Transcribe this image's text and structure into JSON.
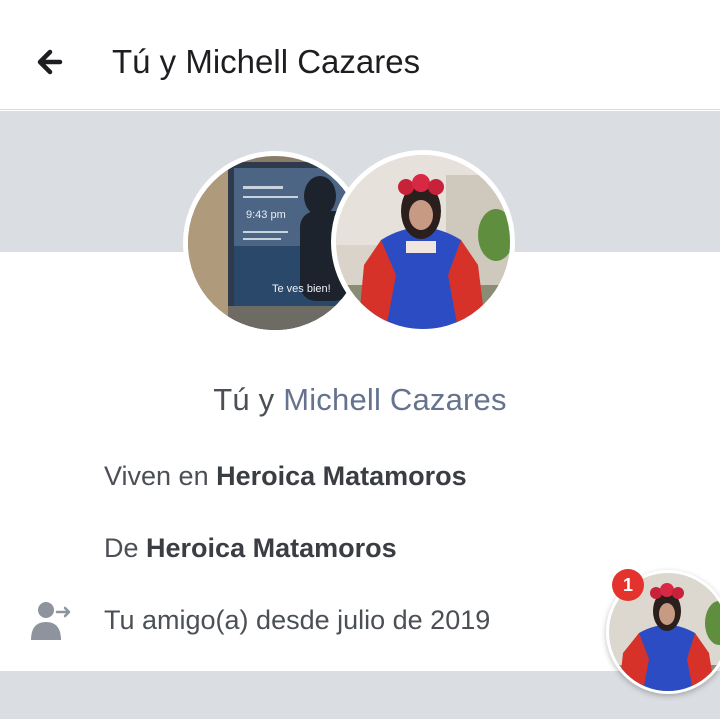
{
  "header": {
    "back_icon": "arrow-left-icon",
    "title": "Tú y Michell Cazares"
  },
  "avatars": {
    "left_caption": "Te ves bien!",
    "left_time": "9:43 pm"
  },
  "names": {
    "you": "Tú y ",
    "friend": "Michell Cazares"
  },
  "info": {
    "lives_prefix": "Viven en ",
    "lives_place": "Heroica Matamoros",
    "from_prefix": "De ",
    "from_place": "Heroica Matamoros",
    "friends_since": "Tu amigo(a) desde julio de 2019",
    "friends_icon": "person-arrow-icon"
  },
  "chat_head": {
    "badge_count": "1"
  },
  "colors": {
    "banner": "#dadde1",
    "friend_link": "#65738f",
    "badge": "#e4332c"
  }
}
